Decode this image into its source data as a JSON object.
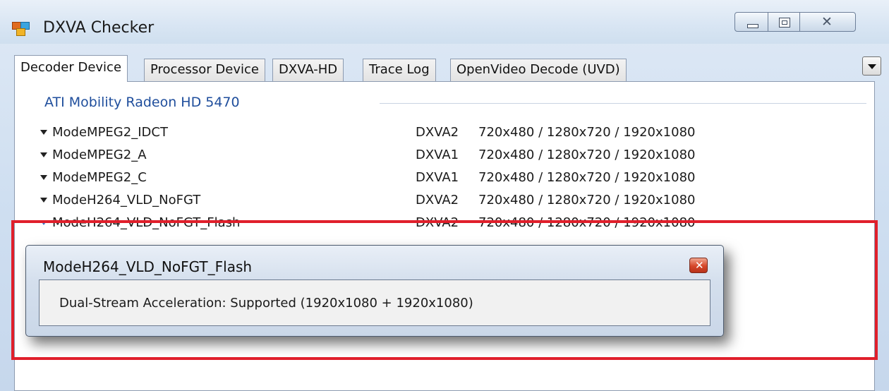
{
  "window": {
    "title": "DXVA Checker",
    "close_glyph": "✕"
  },
  "tabs": [
    {
      "label": "Decoder Device",
      "active": true
    },
    {
      "label": "Processor Device",
      "active": false
    },
    {
      "label": "DXVA-HD",
      "active": false
    },
    {
      "label": "Trace Log",
      "active": false
    },
    {
      "label": "OpenVideo Decode (UVD)",
      "active": false
    }
  ],
  "device": {
    "name": "ATI Mobility Radeon HD 5470"
  },
  "decoders": [
    {
      "name": "ModeMPEG2_IDCT",
      "api": "DXVA2",
      "resolutions": "720x480 / 1280x720 / 1920x1080"
    },
    {
      "name": "ModeMPEG2_A",
      "api": "DXVA1",
      "resolutions": "720x480 / 1280x720 / 1920x1080"
    },
    {
      "name": "ModeMPEG2_C",
      "api": "DXVA1",
      "resolutions": "720x480 / 1280x720 / 1920x1080"
    },
    {
      "name": "ModeH264_VLD_NoFGT",
      "api": "DXVA2",
      "resolutions": "720x480 / 1280x720 / 1920x1080"
    },
    {
      "name": "ModeH264_VLD_NoFGT_Flash",
      "api": "DXVA2",
      "resolutions": "720x480 / 1280x720 / 1920x1080"
    }
  ],
  "popup": {
    "title": "ModeH264_VLD_NoFGT_Flash",
    "close_glyph": "✕",
    "message": "Dual-Stream Acceleration:  Supported  (1920x1080 + 1920x1080)"
  },
  "colors": {
    "highlight": "#e01f2b",
    "group_header": "#1f4e9c"
  }
}
